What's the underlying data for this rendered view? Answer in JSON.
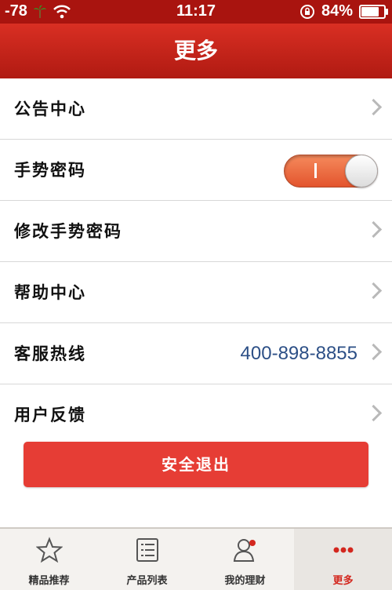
{
  "status": {
    "signal": "-78",
    "time": "11:17",
    "battery": "84%",
    "battery_level": 0.84
  },
  "nav": {
    "title": "更多"
  },
  "rows": [
    {
      "label": "公告中心"
    },
    {
      "label": "手势密码",
      "toggle_on": true
    },
    {
      "label": "修改手势密码"
    },
    {
      "label": "帮助中心"
    },
    {
      "label": "客服热线",
      "value": "400-898-8855"
    },
    {
      "label": "用户反馈"
    }
  ],
  "logout_label": "安全退出",
  "tabs": [
    {
      "label": "精品推荐",
      "icon": "star-icon"
    },
    {
      "label": "产品列表",
      "icon": "list-icon"
    },
    {
      "label": "我的理财",
      "icon": "person-icon"
    },
    {
      "label": "更多",
      "icon": "more-icon",
      "active": true
    }
  ],
  "colors": {
    "brand": "#c8221a",
    "logout": "#e63d35",
    "toggle_on": "#ee6a3e",
    "hotline": "#2c4f86"
  }
}
